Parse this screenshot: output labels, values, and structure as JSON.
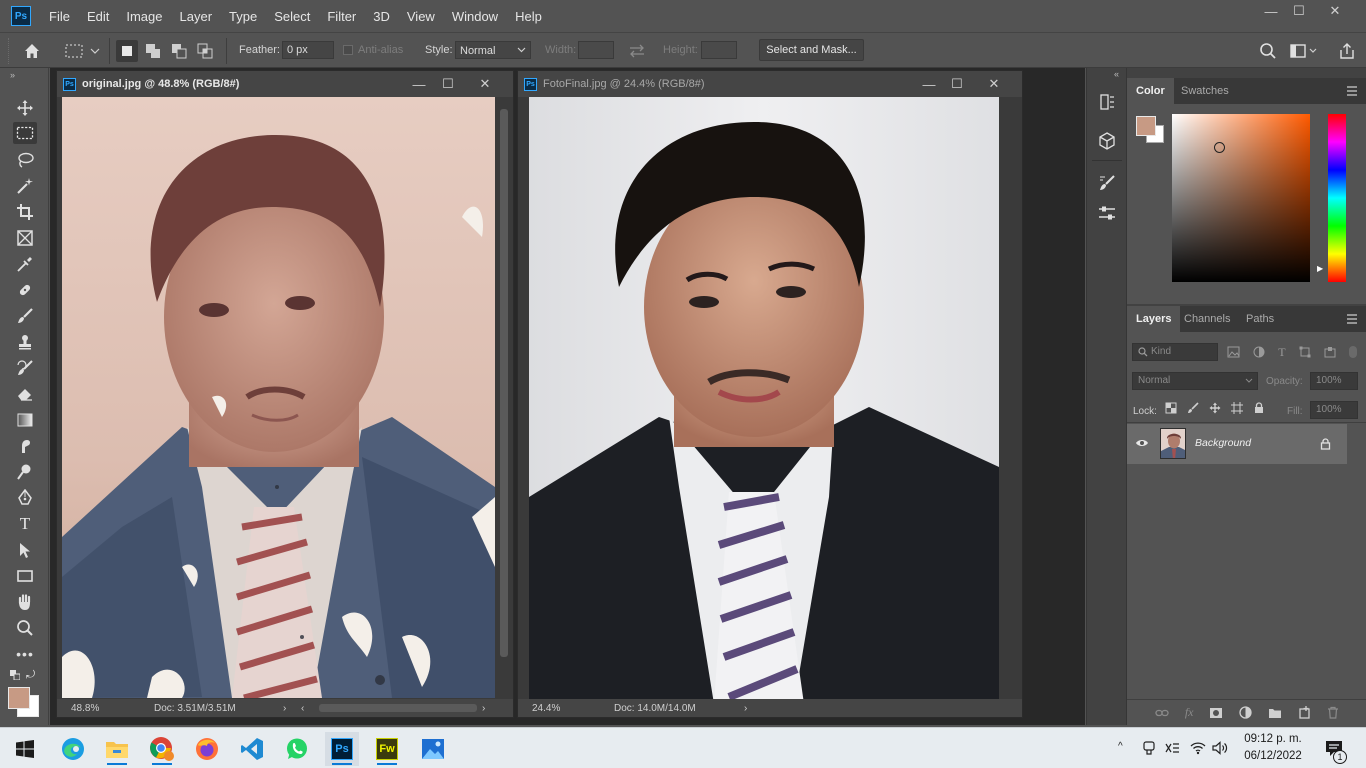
{
  "app": {
    "logo_text": "Ps",
    "menu": [
      "File",
      "Edit",
      "Image",
      "Layer",
      "Type",
      "Select",
      "Filter",
      "3D",
      "View",
      "Window",
      "Help"
    ],
    "window_controls": {
      "minimize": "—",
      "maximize": "☐",
      "close": "✕"
    }
  },
  "options_bar": {
    "feather_label": "Feather:",
    "feather_value": "0 px",
    "antialias_label": "Anti-alias",
    "style_label": "Style:",
    "style_value": "Normal",
    "width_label": "Width:",
    "height_label": "Height:",
    "select_mask_label": "Select and Mask..."
  },
  "tools": [
    "move-tool",
    "marquee-tool",
    "lasso-tool",
    "magic-wand-tool",
    "crop-tool",
    "frame-tool",
    "eyedropper-tool",
    "healing-brush-tool",
    "brush-tool",
    "clone-stamp-tool",
    "history-brush-tool",
    "eraser-tool",
    "gradient-tool",
    "smudge-tool",
    "dodge-tool",
    "pen-tool",
    "type-tool",
    "path-selection-tool",
    "rectangle-tool",
    "hand-tool",
    "zoom-tool",
    "more-tools"
  ],
  "documents": [
    {
      "title": "original.jpg @ 48.8% (RGB/8#)",
      "zoom": "48.8%",
      "doc_size": "Doc: 3.51M/3.51M",
      "active": true
    },
    {
      "title": "FotoFinal.jpg @ 24.4% (RGB/8#)",
      "zoom": "24.4%",
      "doc_size": "Doc: 14.0M/14.0M",
      "active": false
    }
  ],
  "color_panel": {
    "tabs": [
      "Color",
      "Swatches"
    ],
    "active_tab": "Color",
    "foreground_color": "#c79a84",
    "background_color": "#ffffff",
    "picker_hue_color": "#ff5a00"
  },
  "layers_panel": {
    "tabs": [
      "Layers",
      "Channels",
      "Paths"
    ],
    "active_tab": "Layers",
    "filter_placeholder": "Kind",
    "blend_mode": "Normal",
    "opacity_label": "Opacity:",
    "opacity_value": "100%",
    "lock_label": "Lock:",
    "fill_label": "Fill:",
    "fill_value": "100%",
    "layers": [
      {
        "name": "Background",
        "visible": true,
        "locked": true
      }
    ]
  },
  "taskbar": {
    "apps": [
      "windows-start",
      "edge",
      "file-explorer",
      "chrome",
      "firefox",
      "vscode",
      "whatsapp",
      "photoshop",
      "fireworks",
      "photos"
    ],
    "time": "09:12 p. m.",
    "date": "06/12/2022",
    "notification_count": "1",
    "accent_color": "#0a7ad6"
  }
}
